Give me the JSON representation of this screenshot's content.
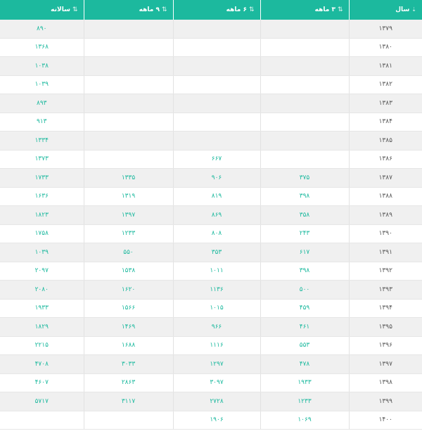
{
  "table": {
    "headers": [
      {
        "key": "year",
        "label": "سال",
        "icon": "sort-alpha-icon"
      },
      {
        "key": "m3",
        "label": "۳ ماهه",
        "icon": "sort-arrows-icon"
      },
      {
        "key": "m6",
        "label": "۶ ماهه",
        "icon": "sort-arrows-icon"
      },
      {
        "key": "m9",
        "label": "۹ ماهه",
        "icon": "sort-arrows-icon"
      },
      {
        "key": "annual",
        "label": "سالانه",
        "icon": "sort-arrows-icon"
      }
    ],
    "rows": [
      {
        "year": "۱۳۷۹",
        "m3": "",
        "m6": "",
        "m9": "",
        "annual": "۸۹۰"
      },
      {
        "year": "۱۳۸۰",
        "m3": "",
        "m6": "",
        "m9": "",
        "annual": "۱۳۶۸"
      },
      {
        "year": "۱۳۸۱",
        "m3": "",
        "m6": "",
        "m9": "",
        "annual": "۱۰۳۸"
      },
      {
        "year": "۱۳۸۲",
        "m3": "",
        "m6": "",
        "m9": "",
        "annual": "۱۰۳۹"
      },
      {
        "year": "۱۳۸۳",
        "m3": "",
        "m6": "",
        "m9": "",
        "annual": "۸۹۳"
      },
      {
        "year": "۱۳۸۴",
        "m3": "",
        "m6": "",
        "m9": "",
        "annual": "۹۱۳"
      },
      {
        "year": "۱۳۸۵",
        "m3": "",
        "m6": "",
        "m9": "",
        "annual": "۱۳۳۴"
      },
      {
        "year": "۱۳۸۶",
        "m3": "",
        "m6": "۶۶۷",
        "m9": "",
        "annual": "۱۳۷۳"
      },
      {
        "year": "۱۳۸۷",
        "m3": "۳۷۵",
        "m6": "۹۰۶",
        "m9": "۱۳۳۵",
        "annual": "۱۷۳۳"
      },
      {
        "year": "۱۳۸۸",
        "m3": "۳۹۸",
        "m6": "۸۱۹",
        "m9": "۱۳۱۹",
        "annual": "۱۶۳۶"
      },
      {
        "year": "۱۳۸۹",
        "m3": "۳۵۸",
        "m6": "۸۶۹",
        "m9": "۱۳۹۷",
        "annual": "۱۸۲۳"
      },
      {
        "year": "۱۳۹۰",
        "m3": "۲۴۳",
        "m6": "۸۰۸",
        "m9": "۱۲۳۳",
        "annual": "۱۷۵۸"
      },
      {
        "year": "۱۳۹۱",
        "m3": "۶۱۷",
        "m6": "۳۵۳",
        "m9": "۵۵۰",
        "annual": "۱۰۳۹"
      },
      {
        "year": "۱۳۹۲",
        "m3": "۳۹۸",
        "m6": "۱۰۱۱",
        "m9": "۱۵۳۸",
        "annual": "۲۰۹۷"
      },
      {
        "year": "۱۳۹۳",
        "m3": "۵۰۰",
        "m6": "۱۱۳۶",
        "m9": "۱۶۲۰",
        "annual": "۲۰۸۰"
      },
      {
        "year": "۱۳۹۴",
        "m3": "۴۵۹",
        "m6": "۱۰۱۵",
        "m9": "۱۵۶۶",
        "annual": "۱۹۳۳"
      },
      {
        "year": "۱۳۹۵",
        "m3": "۴۶۱",
        "m6": "۹۶۶",
        "m9": "۱۴۶۹",
        "annual": "۱۸۲۹"
      },
      {
        "year": "۱۳۹۶",
        "m3": "۵۵۳",
        "m6": "۱۱۱۶",
        "m9": "۱۶۸۸",
        "annual": "۲۲۱۵"
      },
      {
        "year": "۱۳۹۷",
        "m3": "۴۷۸",
        "m6": "۱۲۹۷",
        "m9": "۳۰۳۳",
        "annual": "۴۷۰۸"
      },
      {
        "year": "۱۳۹۸",
        "m3": "۱۹۳۳",
        "m6": "۳۰۹۷",
        "m9": "۲۸۶۳",
        "annual": "۴۶۰۷"
      },
      {
        "year": "۱۳۹۹",
        "m3": "۱۲۳۳",
        "m6": "۲۷۲۸",
        "m9": "۳۱۱۷",
        "annual": "۵۷۱۷"
      },
      {
        "year": "۱۴۰۰",
        "m3": "۱۰۶۹",
        "m6": "۱۹۰۶",
        "m9": "",
        "annual": ""
      }
    ]
  },
  "colors": {
    "header_bg": "#1cb99e",
    "value_text": "#1cb99e",
    "year_text": "#555555",
    "row_alt_bg": "#f0f0f0"
  }
}
